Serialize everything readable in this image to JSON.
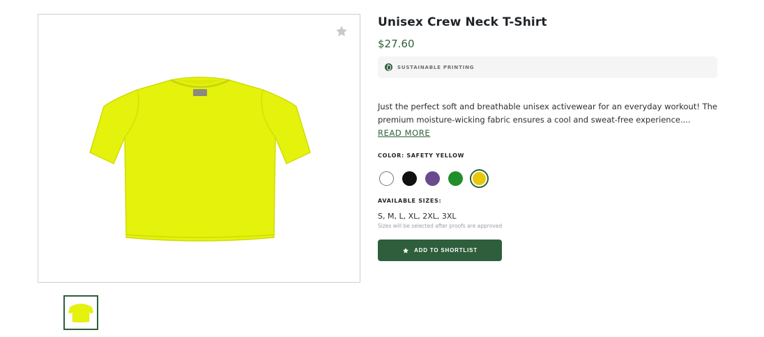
{
  "product": {
    "title": "Unisex Crew Neck T-Shirt",
    "price": "$27.60",
    "badge": {
      "icon": "leaf-icon",
      "label": "SUSTAINABLE PRINTING"
    },
    "description": "Just the perfect soft and breathable unisex activewear for an everyday workout! The premium moisture-wicking fabric ensures a cool and sweat-free experience....",
    "read_more": "READ MORE"
  },
  "gallery": {
    "favorite_icon": "star-icon",
    "shirt_color": "#e5f20c"
  },
  "color": {
    "label": "COLOR: SAFETY YELLOW",
    "swatches": [
      {
        "name": "white",
        "hex": "#ffffff"
      },
      {
        "name": "black",
        "hex": "#111111"
      },
      {
        "name": "purple",
        "hex": "#6a4a8e"
      },
      {
        "name": "green",
        "hex": "#1f8f2a"
      },
      {
        "name": "safety yellow",
        "hex": "#e7c80b",
        "selected": true
      }
    ]
  },
  "sizes": {
    "label": "AVAILABLE SIZES:",
    "values": "S, M, L, XL, 2XL, 3XL",
    "note": "Sizes will be selected after proofs are approved"
  },
  "actions": {
    "add_to_shortlist": "ADD TO SHORTLIST",
    "add_icon": "star-icon"
  },
  "colors": {
    "accent": "#2e5e3b"
  }
}
